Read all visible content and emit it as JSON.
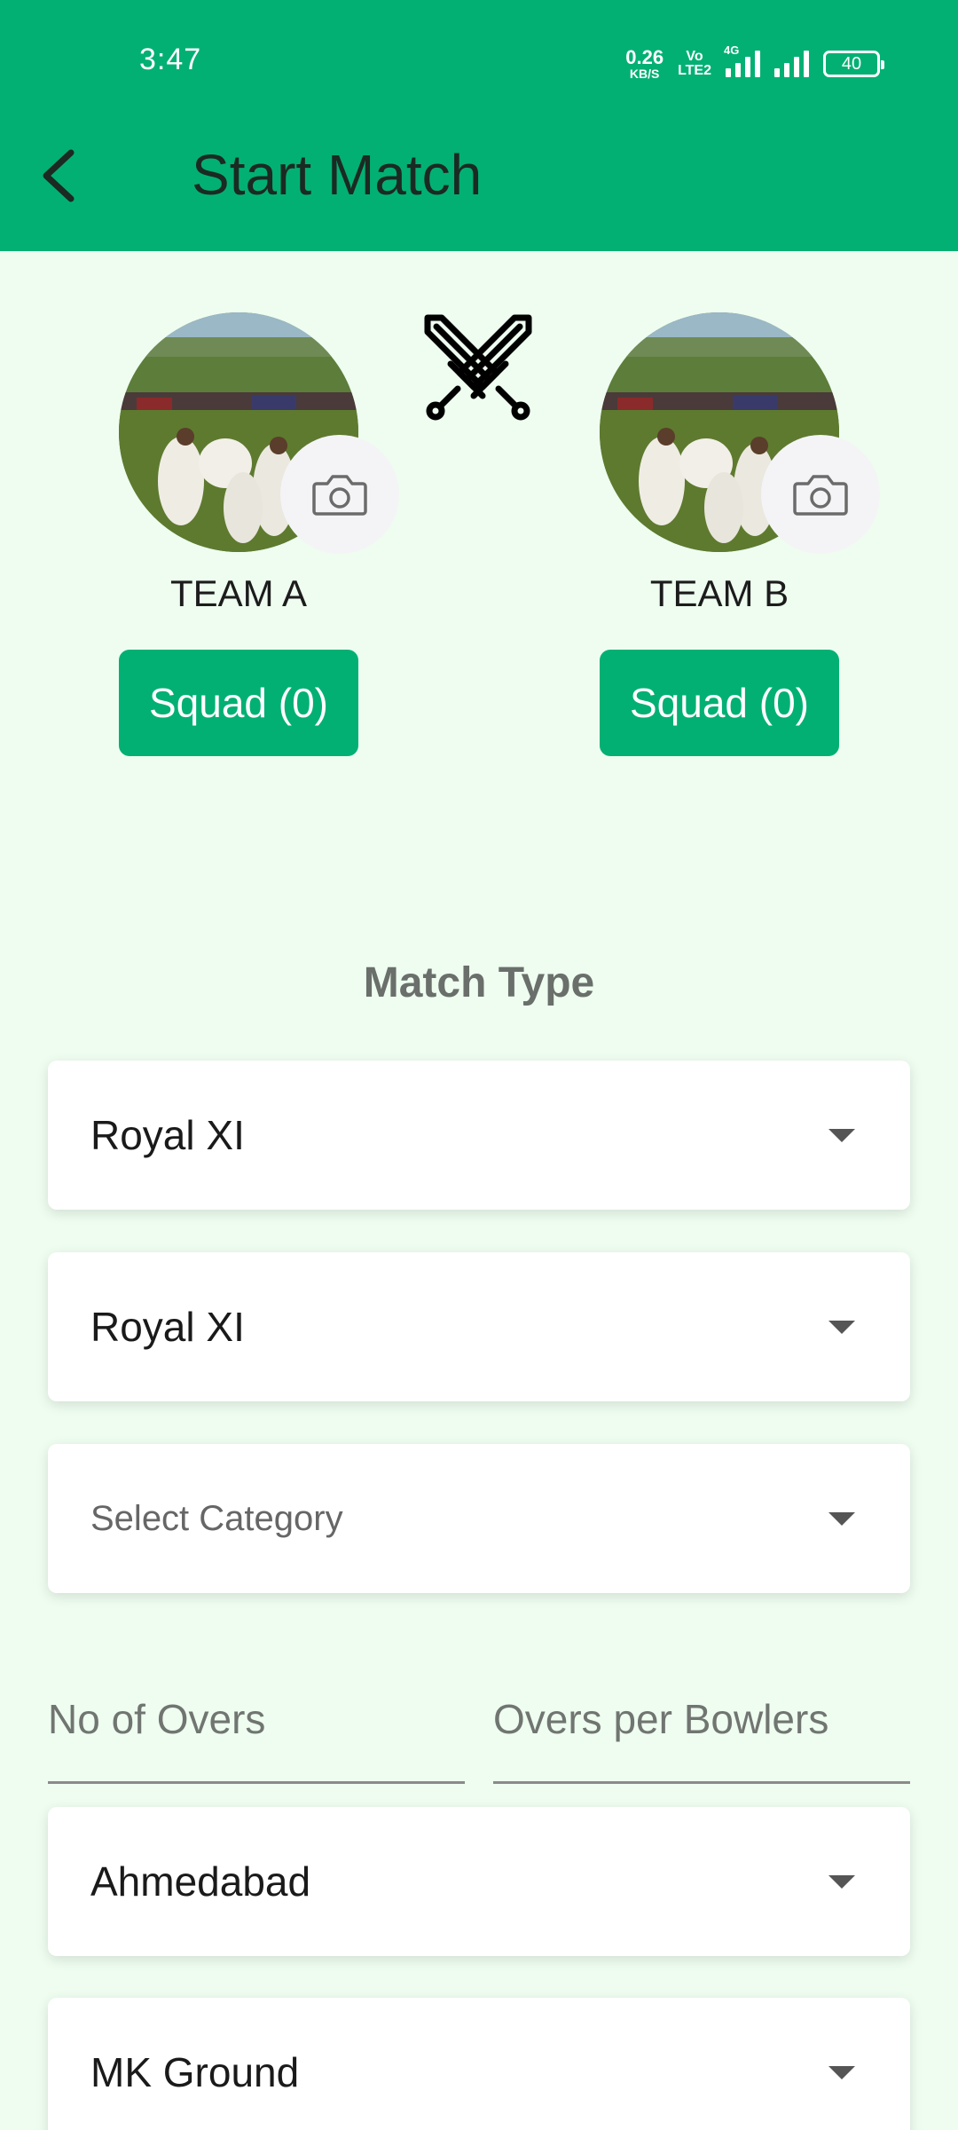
{
  "status_bar": {
    "time": "3:47",
    "net_speed_value": "0.26",
    "net_speed_unit": "KB/S",
    "volte_top": "Vo",
    "volte_bottom": "LTE2",
    "network_type": "4G",
    "battery": "40"
  },
  "header": {
    "title": "Start Match"
  },
  "teams": {
    "team_a": {
      "name": "TEAM A",
      "squad_label": "Squad (0)"
    },
    "team_b": {
      "name": "TEAM B",
      "squad_label": "Squad (0)"
    }
  },
  "match_type": {
    "label": "Match Type"
  },
  "dropdowns": {
    "team_a_select": "Royal XI",
    "team_b_select": "Royal XI",
    "category_placeholder": "Select Category",
    "city": "Ahmedabad",
    "ground": "MK Ground"
  },
  "fields": {
    "overs_placeholder": "No of Overs",
    "overs_per_bowler_placeholder": "Overs per Bowlers"
  },
  "colors": {
    "primary": "#03b074",
    "background": "#eefdf0"
  },
  "icons": {
    "back": "chevron-left",
    "camera": "camera",
    "versus": "crossed-swords",
    "dropdown": "caret-down"
  }
}
